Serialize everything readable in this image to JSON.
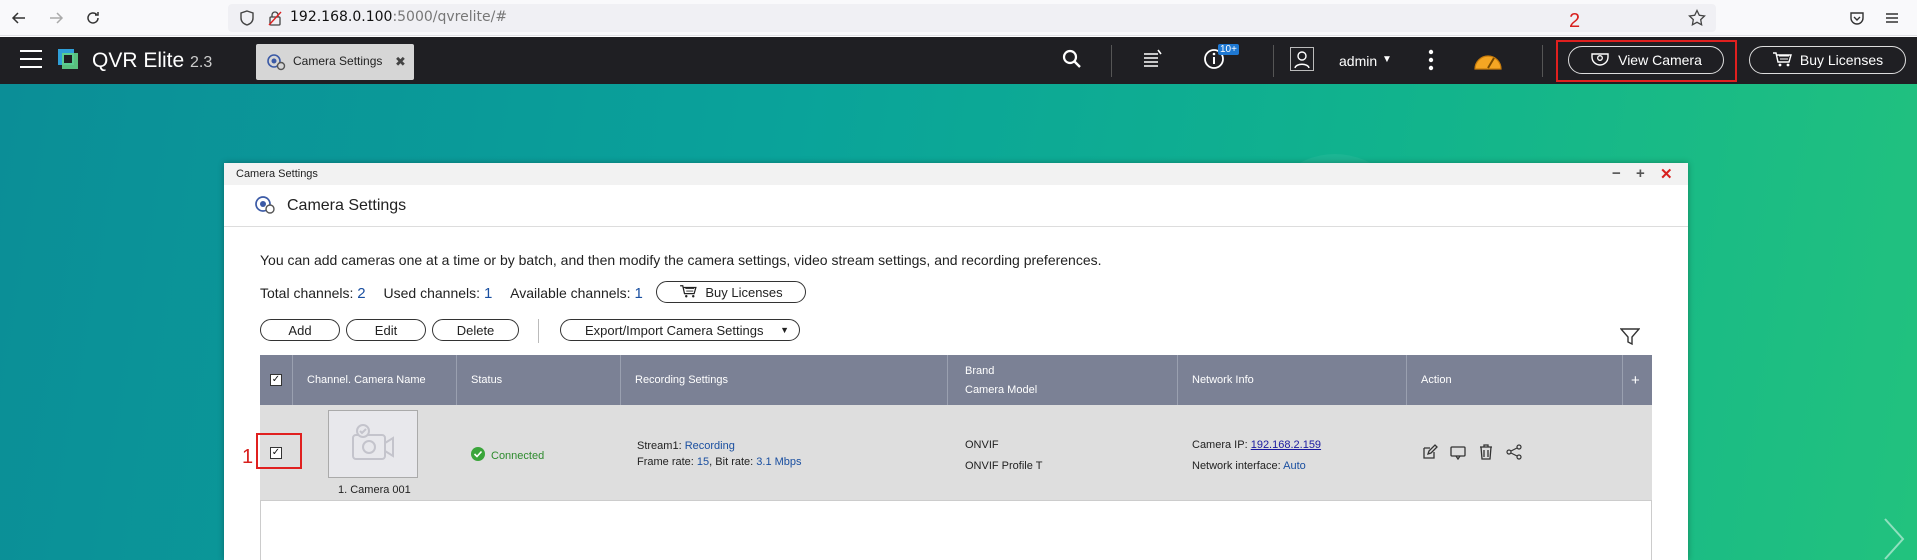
{
  "browser": {
    "url_host": "192.168.0.100",
    "url_rest": ":5000/qvrelite/#"
  },
  "header": {
    "app_name": "QVR Elite",
    "app_version": "2.3",
    "tab_label": "Camera Settings",
    "notification_badge": "10+",
    "user_name": "admin",
    "view_camera_label": "View Camera",
    "buy_licenses_label": "Buy Licenses"
  },
  "annotations": {
    "one": "1",
    "two": "2"
  },
  "window": {
    "title": "Camera Settings",
    "heading": "Camera Settings",
    "description": "You can add cameras one at a time or by batch, and then modify the camera settings, video stream settings, and recording preferences.",
    "total_label": "Total channels:",
    "total_value": "2",
    "used_label": "Used channels:",
    "used_value": "1",
    "available_label": "Available channels:",
    "available_value": "1",
    "buy_licenses_label": "Buy Licenses",
    "toolbar": {
      "add": "Add",
      "edit": "Edit",
      "delete": "Delete",
      "export_import": "Export/Import Camera Settings"
    }
  },
  "table": {
    "columns": {
      "channel": "Channel. Camera Name",
      "status": "Status",
      "recording": "Recording Settings",
      "brand": "Brand",
      "model": "Camera Model",
      "network": "Network Info",
      "action": "Action",
      "add": "+"
    },
    "row": {
      "camera_name": "1. Camera 001",
      "status": "Connected",
      "stream_label": "Stream1:",
      "stream_value": "Recording",
      "frame_rate_label": "Frame rate:",
      "frame_rate_value": "15",
      "bit_rate_label": "Bit rate:",
      "bit_rate_value": "3.1 Mbps",
      "brand": "ONVIF",
      "model": "ONVIF Profile T",
      "camera_ip_label": "Camera IP:",
      "camera_ip": "192.168.2.159",
      "network_interface_label": "Network interface:",
      "network_interface": "Auto"
    }
  },
  "colors": {
    "accent_red": "#e0201f",
    "header_bg": "#1f1f23",
    "table_header_bg": "#7b8195",
    "status_green": "#3aa53a"
  }
}
